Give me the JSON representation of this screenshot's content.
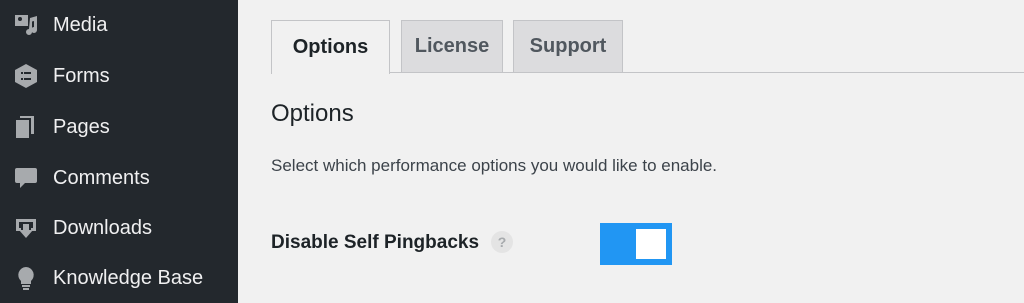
{
  "sidebar": {
    "items": [
      {
        "label": "Media",
        "icon": "media-icon"
      },
      {
        "label": "Forms",
        "icon": "forms-icon"
      },
      {
        "label": "Pages",
        "icon": "pages-icon"
      },
      {
        "label": "Comments",
        "icon": "comments-icon"
      },
      {
        "label": "Downloads",
        "icon": "downloads-icon"
      },
      {
        "label": "Knowledge Base",
        "icon": "lightbulb-icon"
      }
    ]
  },
  "tabs": [
    {
      "label": "Options",
      "active": true
    },
    {
      "label": "License",
      "active": false
    },
    {
      "label": "Support",
      "active": false
    }
  ],
  "main": {
    "section_title": "Options",
    "description": "Select which performance options you would like to enable.",
    "option": {
      "label": "Disable Self Pingbacks",
      "help": "?",
      "enabled": true
    }
  },
  "colors": {
    "sidebar_bg": "#23282d",
    "content_bg": "#f1f1f1",
    "toggle_on": "#2196f3"
  }
}
